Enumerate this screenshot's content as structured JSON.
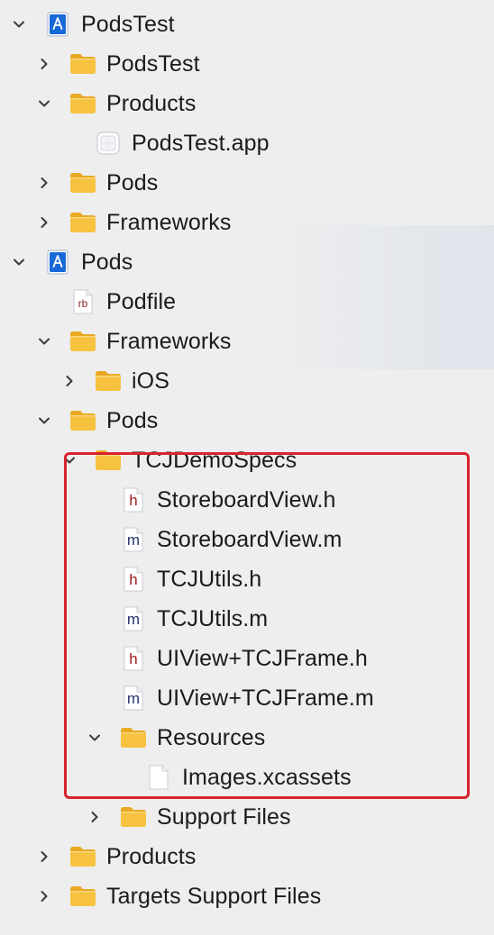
{
  "colors": {
    "folder": "#f6c23f",
    "folder_dark": "#e9a922",
    "project_blue": "#1769d8",
    "highlight": "#d9232e"
  },
  "tree": [
    {
      "label": "PodsTest",
      "icon": "project-icon",
      "disclosure": "expanded"
    },
    {
      "label": "PodsTest",
      "icon": "folder-icon",
      "disclosure": "collapsed"
    },
    {
      "label": "Products",
      "icon": "folder-icon",
      "disclosure": "expanded"
    },
    {
      "label": "PodsTest.app",
      "icon": "app-icon",
      "disclosure": "none"
    },
    {
      "label": "Pods",
      "icon": "folder-icon",
      "disclosure": "collapsed"
    },
    {
      "label": "Frameworks",
      "icon": "folder-icon",
      "disclosure": "collapsed"
    },
    {
      "label": "Pods",
      "icon": "project-icon",
      "disclosure": "expanded"
    },
    {
      "label": "Podfile",
      "icon": "ruby-file-icon",
      "disclosure": "none",
      "badge": "rb"
    },
    {
      "label": "Frameworks",
      "icon": "folder-icon",
      "disclosure": "expanded"
    },
    {
      "label": "iOS",
      "icon": "folder-icon",
      "disclosure": "collapsed"
    },
    {
      "label": "Pods",
      "icon": "folder-icon",
      "disclosure": "expanded"
    },
    {
      "label": "TCJDemoSpecs",
      "icon": "folder-icon",
      "disclosure": "expanded"
    },
    {
      "label": "StoreboardView.h",
      "icon": "header-file-icon",
      "disclosure": "none",
      "badge": "h"
    },
    {
      "label": "StoreboardView.m",
      "icon": "implementation-file-icon",
      "disclosure": "none",
      "badge": "m"
    },
    {
      "label": "TCJUtils.h",
      "icon": "header-file-icon",
      "disclosure": "none",
      "badge": "h"
    },
    {
      "label": "TCJUtils.m",
      "icon": "implementation-file-icon",
      "disclosure": "none",
      "badge": "m"
    },
    {
      "label": "UIView+TCJFrame.h",
      "icon": "header-file-icon",
      "disclosure": "none",
      "badge": "h"
    },
    {
      "label": "UIView+TCJFrame.m",
      "icon": "implementation-file-icon",
      "disclosure": "none",
      "badge": "m"
    },
    {
      "label": "Resources",
      "icon": "folder-icon",
      "disclosure": "expanded"
    },
    {
      "label": "Images.xcassets",
      "icon": "file-icon",
      "disclosure": "none"
    },
    {
      "label": "Support Files",
      "icon": "folder-icon",
      "disclosure": "collapsed"
    },
    {
      "label": "Products",
      "icon": "folder-icon",
      "disclosure": "collapsed"
    },
    {
      "label": "Targets Support Files",
      "icon": "folder-icon",
      "disclosure": "collapsed"
    }
  ]
}
